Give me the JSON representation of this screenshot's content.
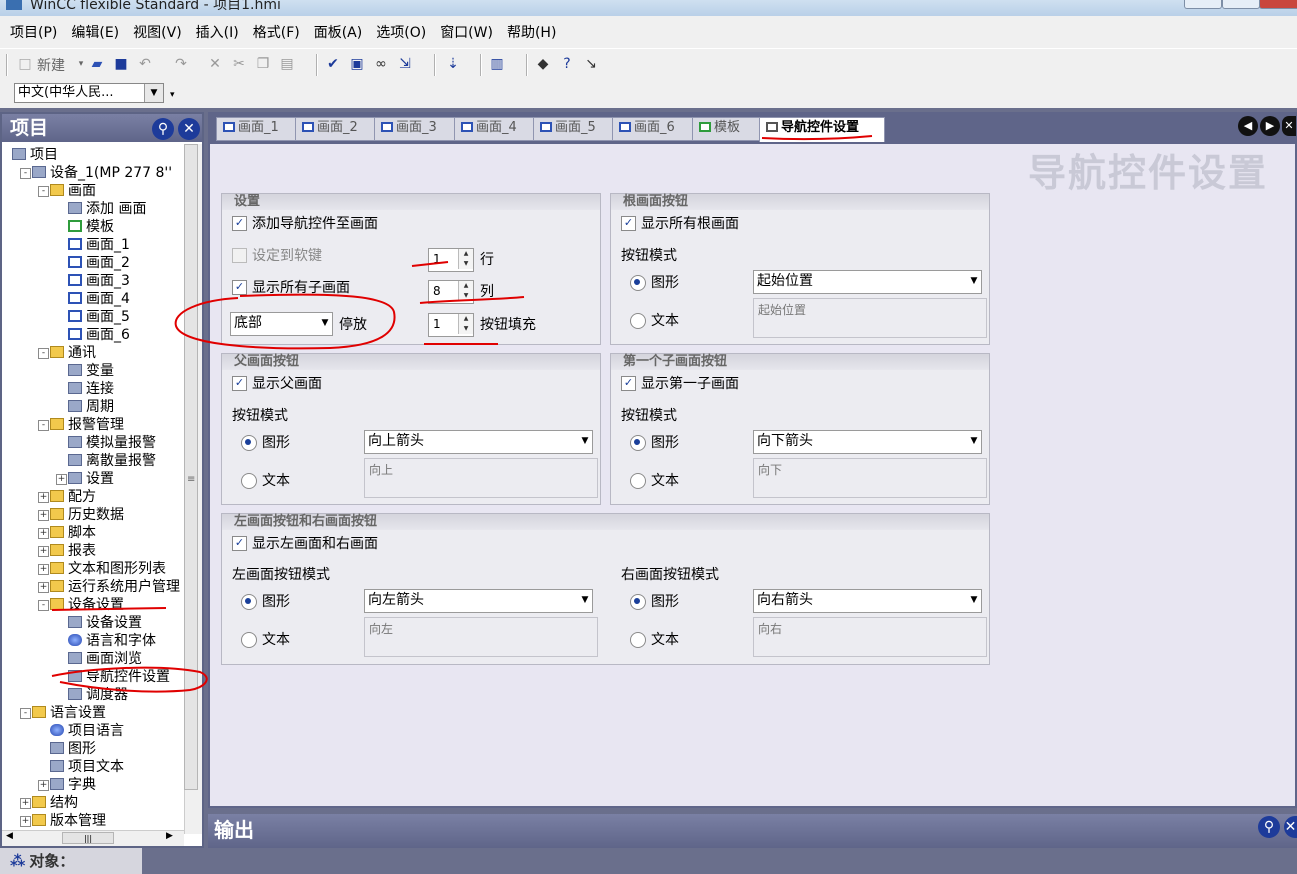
{
  "window": {
    "title": "WinCC flexible Standard - 项目1.hmi"
  },
  "menu": [
    "项目(P)",
    "编辑(E)",
    "视图(V)",
    "插入(I)",
    "格式(F)",
    "面板(A)",
    "选项(O)",
    "窗口(W)",
    "帮助(H)"
  ],
  "toolbar": {
    "new_label": "新建",
    "language_select": "中文(中华人民..."
  },
  "project_pane": {
    "title": "项目",
    "tree": [
      {
        "label": "项目",
        "icon": "project-icon"
      },
      {
        "label": "设备_1(MP 277 8''",
        "icon": "device-icon"
      },
      {
        "label": "画面",
        "icon": "folder-icon"
      },
      {
        "label": "添加 画面",
        "icon": "add-screen-icon"
      },
      {
        "label": "模板",
        "icon": "template-icon"
      },
      {
        "label": "画面_1",
        "icon": "screen-icon"
      },
      {
        "label": "画面_2",
        "icon": "screen-icon"
      },
      {
        "label": "画面_3",
        "icon": "screen-icon"
      },
      {
        "label": "画面_4",
        "icon": "screen-icon"
      },
      {
        "label": "画面_5",
        "icon": "screen-icon"
      },
      {
        "label": "画面_6",
        "icon": "screen-icon"
      },
      {
        "label": "通讯",
        "icon": "folder-icon"
      },
      {
        "label": "变量",
        "icon": "tag-icon"
      },
      {
        "label": "连接",
        "icon": "connection-icon"
      },
      {
        "label": "周期",
        "icon": "cycle-icon"
      },
      {
        "label": "报警管理",
        "icon": "folder-icon"
      },
      {
        "label": "模拟量报警",
        "icon": "analog-alarm-icon"
      },
      {
        "label": "离散量报警",
        "icon": "discrete-alarm-icon"
      },
      {
        "label": "设置",
        "icon": "settings-icon"
      },
      {
        "label": "配方",
        "icon": "folder-icon"
      },
      {
        "label": "历史数据",
        "icon": "folder-icon"
      },
      {
        "label": "脚本",
        "icon": "folder-icon"
      },
      {
        "label": "报表",
        "icon": "folder-icon"
      },
      {
        "label": "文本和图形列表",
        "icon": "folder-icon"
      },
      {
        "label": "运行系统用户管理",
        "icon": "folder-icon"
      },
      {
        "label": "设备设置",
        "icon": "folder-icon"
      },
      {
        "label": "设备设置",
        "icon": "device-settings-icon"
      },
      {
        "label": "语言和字体",
        "icon": "globe-icon"
      },
      {
        "label": "画面浏览",
        "icon": "screen-browse-icon"
      },
      {
        "label": "导航控件设置",
        "icon": "nav-settings-icon"
      },
      {
        "label": "调度器",
        "icon": "scheduler-icon"
      },
      {
        "label": "语言设置",
        "icon": "folder-icon"
      },
      {
        "label": "项目语言",
        "icon": "globe-icon"
      },
      {
        "label": "图形",
        "icon": "graphics-icon"
      },
      {
        "label": "项目文本",
        "icon": "text-icon"
      },
      {
        "label": "字典",
        "icon": "dictionary-icon"
      },
      {
        "label": "结构",
        "icon": "folder-icon"
      },
      {
        "label": "版本管理",
        "icon": "folder-icon"
      }
    ]
  },
  "tabs": [
    "画面_1",
    "画面_2",
    "画面_3",
    "画面_4",
    "画面_5",
    "画面_6",
    "模板",
    "导航控件设置"
  ],
  "editor": {
    "title": "导航控件设置",
    "settings": {
      "header": "设置",
      "add_nav": "添加导航控件至画面",
      "set_to_softkey": "设定到软键",
      "show_all_child": "显示所有子画面",
      "rows_value": "1",
      "rows_label": "行",
      "cols_value": "8",
      "cols_label": "列",
      "dock_value": "底部",
      "dock_label": "停放",
      "fill_value": "1",
      "fill_label": "按钮填充"
    },
    "root": {
      "header": "根画面按钮",
      "show": "显示所有根画面",
      "mode_label": "按钮模式",
      "graphic": "图形",
      "text": "文本",
      "graphic_value": "起始位置",
      "text_value": "起始位置"
    },
    "parent": {
      "header": "父画面按钮",
      "show": "显示父画面",
      "mode_label": "按钮模式",
      "graphic": "图形",
      "text": "文本",
      "graphic_value": "向上箭头",
      "text_value": "向上"
    },
    "first_child": {
      "header": "第一个子画面按钮",
      "show": "显示第一子画面",
      "mode_label": "按钮模式",
      "graphic": "图形",
      "text": "文本",
      "graphic_value": "向下箭头",
      "text_value": "向下"
    },
    "left_right": {
      "header": "左画面按钮和右画面按钮",
      "show": "显示左画面和右画面",
      "left_mode": "左画面按钮模式",
      "right_mode": "右画面按钮模式",
      "graphic": "图形",
      "text": "文本",
      "left_graphic_value": "向左箭头",
      "left_text_value": "向左",
      "right_graphic_value": "向右箭头",
      "right_text_value": "向右"
    }
  },
  "output": {
    "title": "输出"
  },
  "status": {
    "objects": "对象："
  },
  "colors": {
    "pane_header": "#5f6589",
    "canvas": "#e8e6f2",
    "annotation_ink": "#e00000"
  }
}
